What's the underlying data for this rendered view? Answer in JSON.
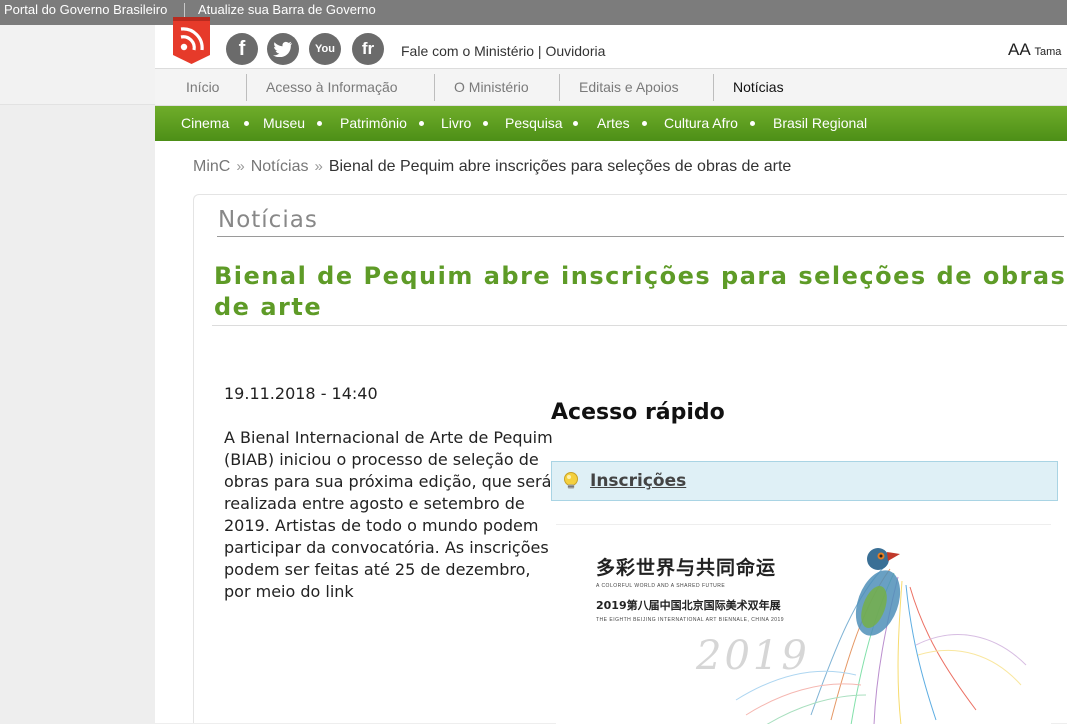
{
  "gov_bar": {
    "portal": "Portal do Governo Brasileiro",
    "update": "Atualize sua Barra de Governo"
  },
  "header": {
    "social": [
      "f",
      "t",
      "You",
      "fr"
    ],
    "links": "Fale com o Ministério | Ouvidoria",
    "font_size_label": "AA",
    "font_size_text": "Tama"
  },
  "nav": {
    "items": [
      "Início",
      "Acesso à Informação",
      "O Ministério",
      "Editais e Apoios",
      "Notícias"
    ],
    "active": "Notícias"
  },
  "green_nav": {
    "items": [
      "Cinema",
      "Museu",
      "Patrimônio",
      "Livro",
      "Pesquisa",
      "Artes",
      "Cultura Afro",
      "Brasil Regional"
    ]
  },
  "breadcrumb": {
    "items": [
      "MinC",
      "Notícias"
    ],
    "current": "Bienal de Pequim abre inscrições para seleções de obras de arte"
  },
  "article": {
    "section": "Notícias",
    "title": "Bienal de Pequim abre inscrições para seleções de obras de arte",
    "date": "19.11.2018 - 14:40",
    "body": "A Bienal Internacional de Arte de Pequim (BIAB) iniciou o processo de seleção de obras para sua próxima edição, que será realizada entre agosto e setembro de 2019. Artistas de todo o mundo podem participar da convocatória. As inscrições podem ser feitas até 25 de dezembro, por meio do link"
  },
  "quick_access": {
    "title": "Acesso rápido",
    "link": "Inscrições"
  },
  "poster": {
    "title_cn": "多彩世界与共同命运",
    "sub1": "A COLORFUL WORLD AND A SHARED FUTURE",
    "sub2_cn": "2019第八届中国北京国际美术双年展",
    "sub3": "THE EIGHTH BEIJING INTERNATIONAL ART BIENNALE, CHINA 2019",
    "year": "2019"
  },
  "colors": {
    "green": "#5e9b27",
    "nav_green": "#4d8f17",
    "rss_red": "#e63a2a"
  }
}
